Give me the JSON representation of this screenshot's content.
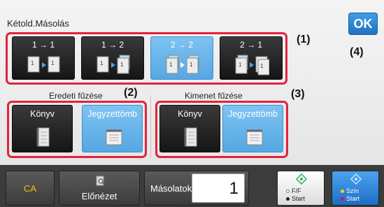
{
  "screen": {
    "title": "Kétold.Másolás",
    "ok_label": "OK"
  },
  "callouts": [
    "(1)",
    "(2)",
    "(3)",
    "(4)"
  ],
  "copy_modes": [
    {
      "label": "1 → 1",
      "selected": false
    },
    {
      "label": "1 → 2",
      "selected": false
    },
    {
      "label": "2 → 2",
      "selected": true
    },
    {
      "label": "2 → 1",
      "selected": false
    }
  ],
  "original_binding": {
    "label": "Eredeti fűzése",
    "options": [
      {
        "label": "Könyv",
        "selected": false
      },
      {
        "label": "Jegyzettömb",
        "selected": true
      }
    ]
  },
  "output_binding": {
    "label": "Kimenet fűzése",
    "options": [
      {
        "label": "Könyv",
        "selected": false
      },
      {
        "label": "Jegyzettömb",
        "selected": true
      }
    ]
  },
  "bottom": {
    "ca_label": "CA",
    "preview_label": "Előnézet",
    "copies_label": "Másolatok",
    "copies_value": "1",
    "start_bw_line1": "F/F",
    "start_bw_line2": "Start",
    "start_color_line1": "Szín",
    "start_color_line2": "Start"
  },
  "colors": {
    "accent_blue": "#1f72c4",
    "selected_blue": "#6cb7ee",
    "highlight_red": "#e0243a",
    "ca_yellow": "#f2c200"
  }
}
